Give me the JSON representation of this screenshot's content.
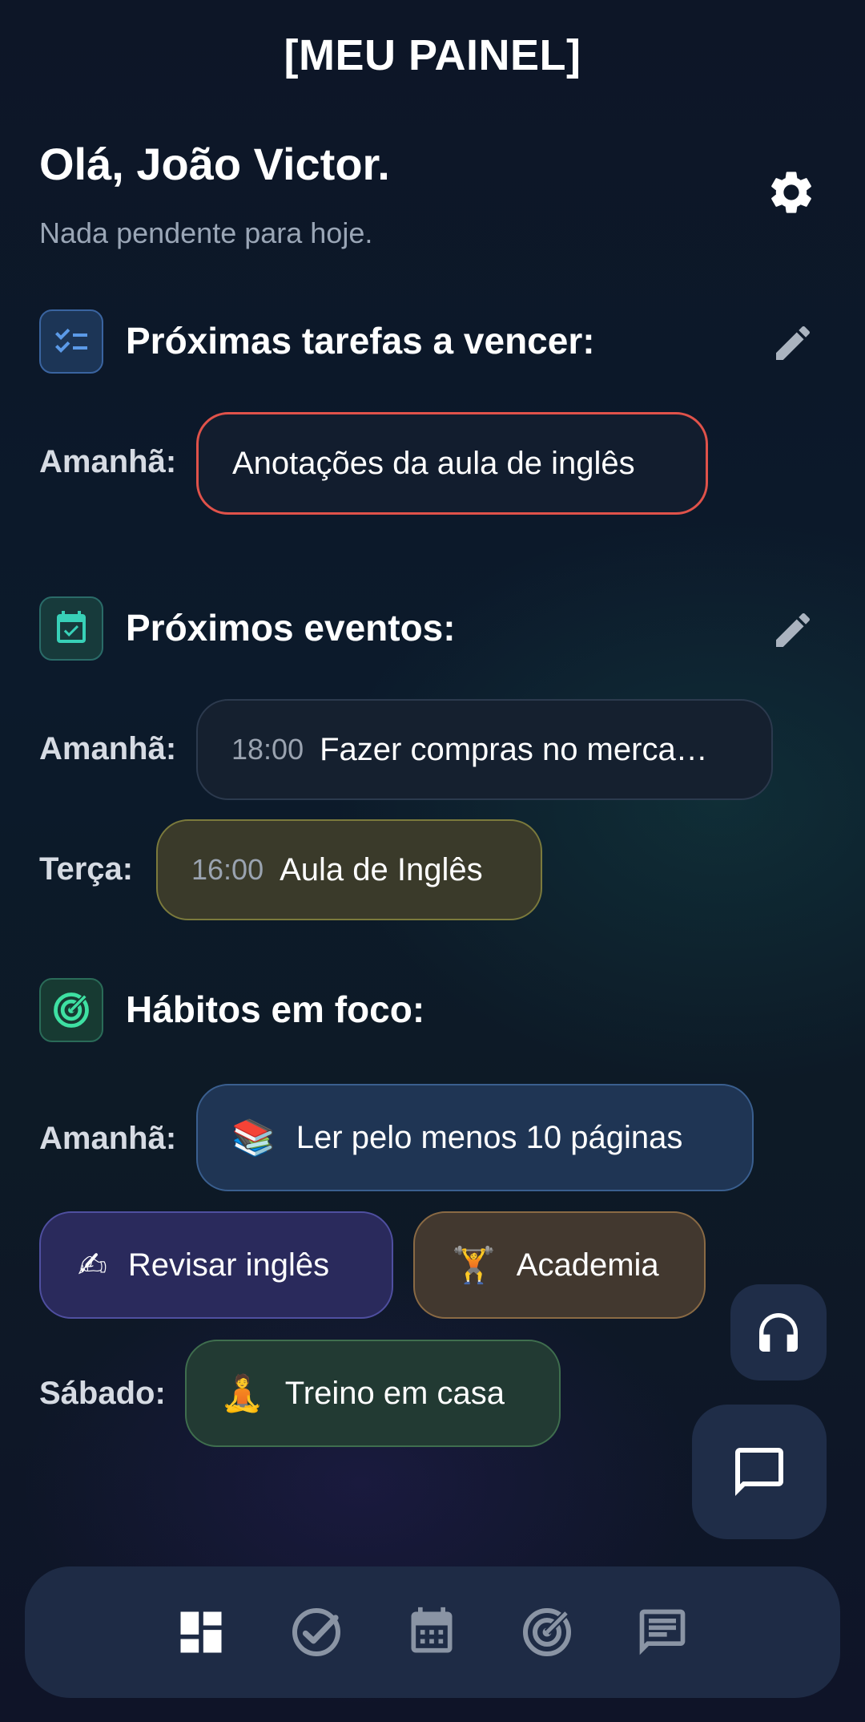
{
  "header": {
    "title": "[MEU PAINEL]"
  },
  "greeting": {
    "title": "Olá, João Victor.",
    "subtitle": "Nada pendente para hoje."
  },
  "icons": {
    "settings": "gear-icon",
    "edit": "pencil-icon",
    "tasks": "checklist-icon",
    "events": "calendar-check-icon",
    "habits": "target-icon"
  },
  "tasks": {
    "title": "Próximas tarefas a vencer:",
    "items": [
      {
        "day": "Amanhã:",
        "text": "Anotações da aula de inglês"
      }
    ]
  },
  "events": {
    "title": "Próximos eventos:",
    "items": [
      {
        "day": "Amanhã:",
        "time": "18:00",
        "text": "Fazer compras no merca…"
      },
      {
        "day": "Terça:",
        "time": "16:00",
        "text": "Aula de Inglês"
      }
    ]
  },
  "habits": {
    "title": "Hábitos em foco:",
    "groups": [
      {
        "day": "Amanhã:",
        "items": [
          {
            "emoji": "📚",
            "text": "Ler pelo menos 10 páginas"
          },
          {
            "emoji": "✍",
            "text": "Revisar inglês"
          },
          {
            "emoji": "🏋",
            "text": "Academia"
          }
        ]
      },
      {
        "day": "Sábado:",
        "items": [
          {
            "emoji": "🧘",
            "text": "Treino em casa"
          }
        ]
      }
    ]
  },
  "fabs": [
    "headphones-icon",
    "chat-icon"
  ],
  "nav": {
    "items": [
      "dashboard-icon",
      "check-circle-icon",
      "calendar-icon",
      "target-icon",
      "chat-icon"
    ],
    "active": "dashboard-icon"
  },
  "colors": {
    "task_border": "#e0524a",
    "event_yellow_bg": "#3a3a2a",
    "habit_blue_bg": "#1f3554",
    "habit_purple_bg": "#2a2a5c",
    "habit_orange_bg": "#42382f",
    "habit_green_bg": "#223a33"
  }
}
